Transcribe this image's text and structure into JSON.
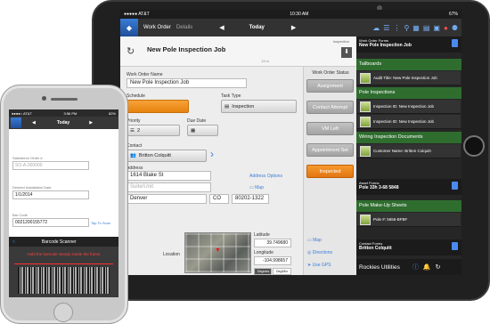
{
  "ipad": {
    "status": {
      "carrier": "●●●●● AT&T",
      "time": "10:30 AM",
      "battery": "67%"
    },
    "nav": {
      "crumb": "Work Order",
      "crumb_sub": "Details",
      "prev": "◀",
      "today": "Today",
      "next": "▶"
    },
    "header": {
      "title": "New Pole Inspection Job",
      "inspection_label": "Inspection",
      "time_note": "13 m"
    },
    "form": {
      "wo_name_label": "Work Order Name",
      "wo_name_value": "New Pole Inspection Job",
      "schedule_label": "Schedule",
      "task_type_label": "Task Type",
      "task_type_value": "Inspection",
      "priority_label": "Priority",
      "priority_value": "2",
      "due_date_label": "Due Date",
      "contact_label": "Contact",
      "contact_value": "Britton Colquitt",
      "address_label": "Address",
      "street": "1614 Blake St",
      "address_options": "Address Options",
      "suite_placeholder": "Suite/Unit",
      "map_link": "Map",
      "city": "Denver",
      "state": "CO",
      "zip": "80202-1322",
      "location_label": "Location",
      "latitude_label": "Latitude",
      "latitude": "39.749680",
      "longitude_label": "Longitude",
      "longitude": "-104.998657",
      "degrees": "Degrees",
      "degmin": "Deg/Min",
      "map_btn": "Map",
      "directions_btn": "Directions",
      "gps_btn": "Use GPS"
    },
    "status_col": {
      "title": "Work Order Status",
      "buttons": [
        "Assignment",
        "Contact Attempt",
        "VM Left",
        "Appointment Set",
        "Inspected"
      ]
    },
    "right": {
      "top_label": "Work Order Forms",
      "top_title": "New Pole Inspection Job",
      "sections": [
        {
          "title": "Tailboards",
          "items": [
            "Audit Title: New Pole Inspection Job"
          ]
        },
        {
          "title": "Pole Inspections",
          "items": [
            "Inspection ID: New Inspection Job",
            "Inspection ID: New Inspection Job"
          ]
        },
        {
          "title": "Wiring Inspection Documents",
          "items": [
            "Customer Name: Britton Colquitt"
          ]
        }
      ],
      "asset_label": "Asset Forms",
      "asset_title": "Pole 33h 3-68 5848",
      "makeup_title": "Pole Make-Up Sheets",
      "makeup_item": "Pole #: 5656-BFBF",
      "contact_forms_label": "Contact Forms",
      "contact_forms_title": "Britton Colquitt",
      "footer": "Rockies Utilities"
    }
  },
  "iphone": {
    "status": {
      "carrier": "●●●●○ AT&T",
      "time": "3:56 PM",
      "battery": "82%"
    },
    "nav": {
      "today": "Today"
    },
    "fields": [
      {
        "label": "Salesforce Order #",
        "value": "SO-A-000000"
      },
      {
        "label": "Desired Installation Date",
        "value": "1/1/2014"
      },
      {
        "label": "Bar Code",
        "value": "0021200155772"
      }
    ],
    "tap_to_scan": "Tap To Scan",
    "scanner_title": "Barcode Scanner",
    "scanner_back": "<",
    "scanner_msg": "Hold the barcode steady inside the frame"
  }
}
